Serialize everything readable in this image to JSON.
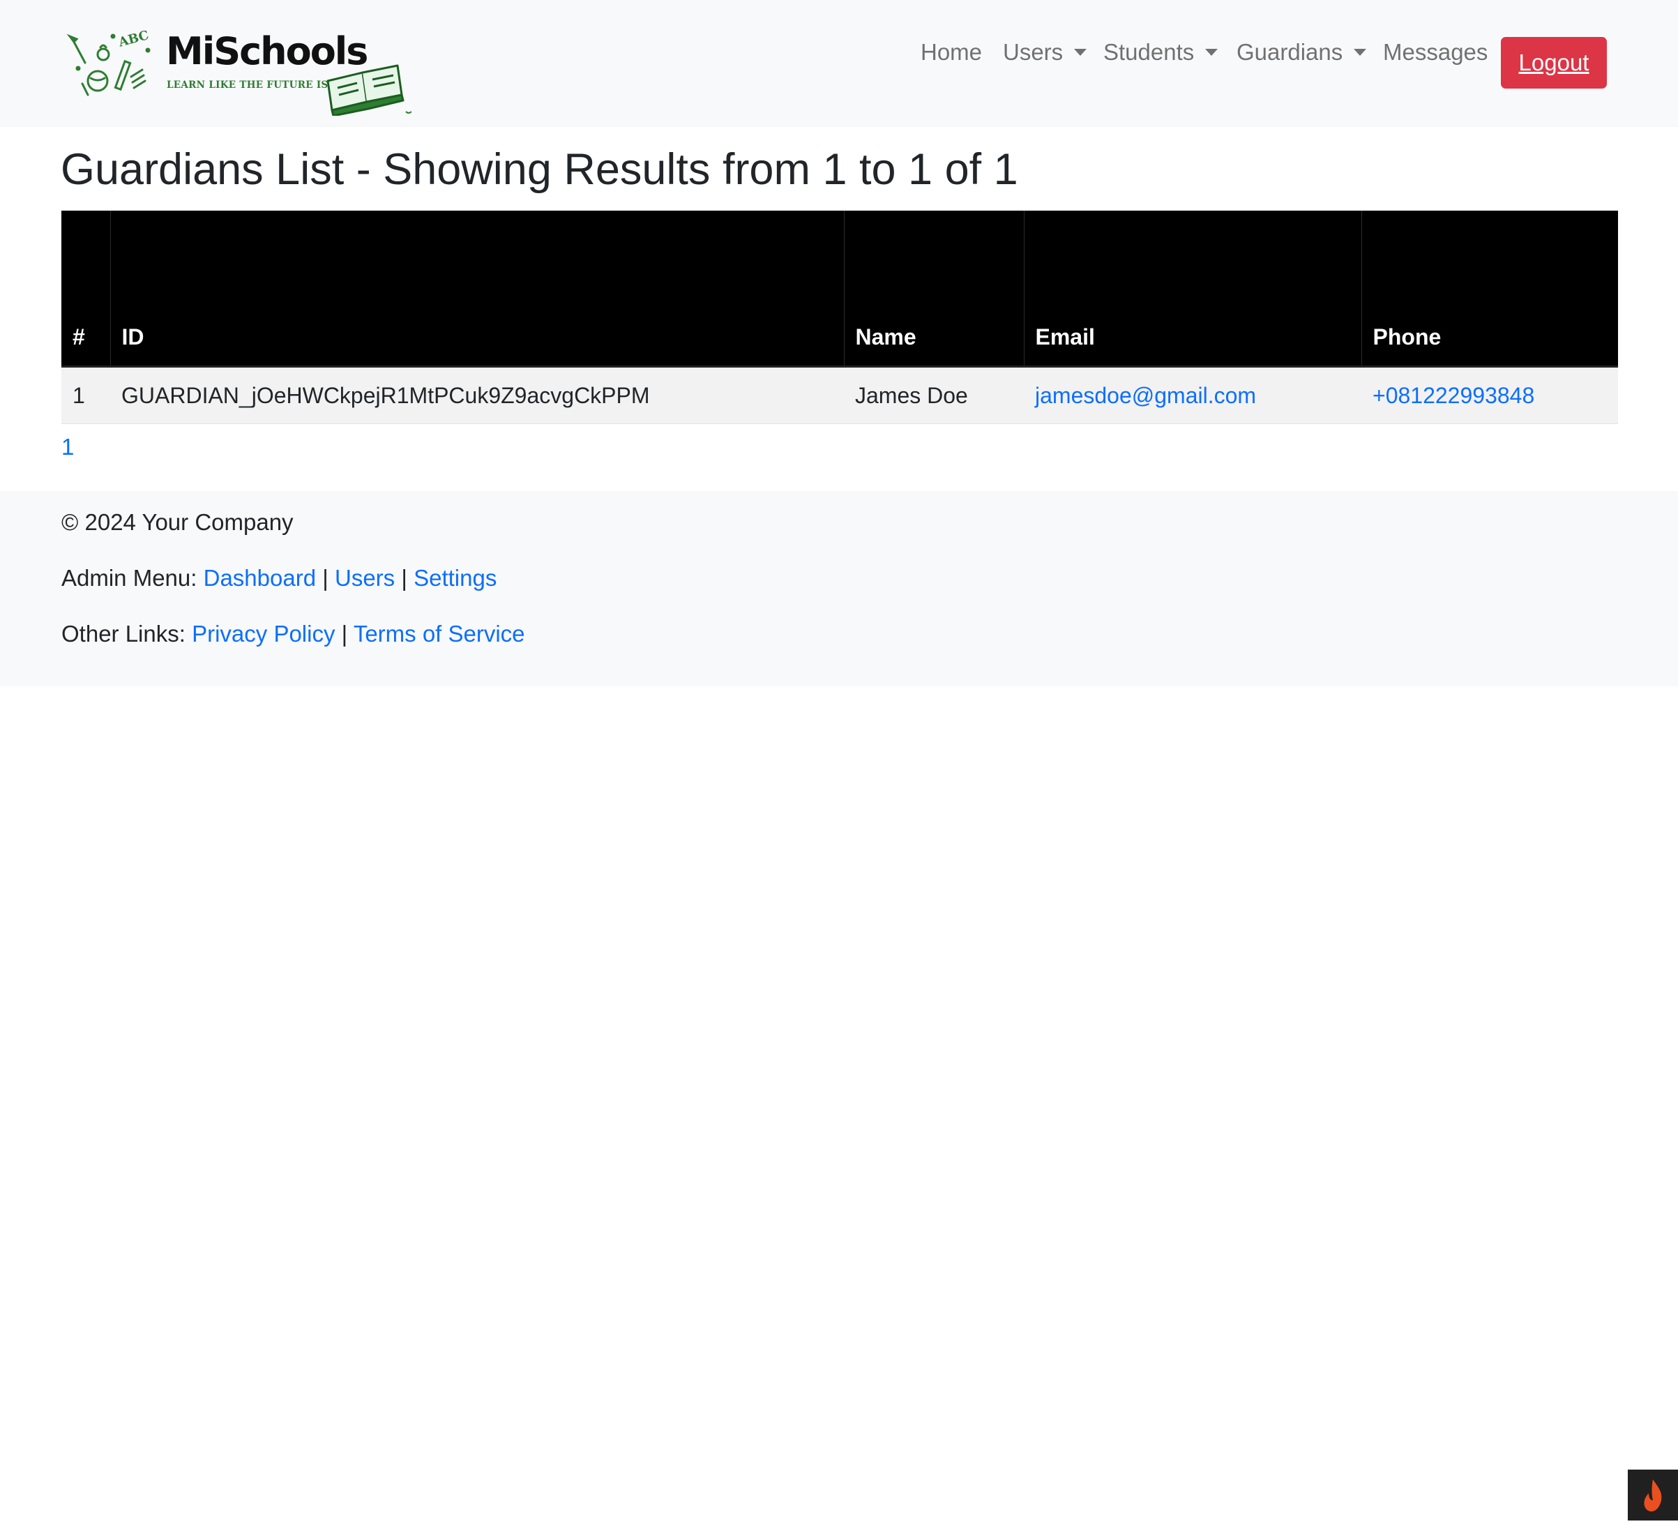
{
  "navbar": {
    "brand": {
      "name": "MiSchools",
      "tagline": "LEARN LIKE THE FUTURE IS NOW"
    },
    "links": [
      {
        "label": "Home",
        "dropdown": false
      },
      {
        "label": "Users",
        "dropdown": true
      },
      {
        "label": "Students",
        "dropdown": true
      },
      {
        "label": "Guardians",
        "dropdown": true
      },
      {
        "label": "Messages",
        "dropdown": false
      }
    ],
    "logout_label": "Logout"
  },
  "main": {
    "title": "Guardians List - Showing Results from 1 to 1 of 1",
    "table": {
      "columns": [
        "#",
        "ID",
        "Name",
        "Email",
        "Phone"
      ],
      "rows": [
        {
          "num": "1",
          "id": "GUARDIAN_jOeHWCkpejR1MtPCuk9Z9acvgCkPPM",
          "name": "James Doe",
          "email": "jamesdoe@gmail.com",
          "phone": "+081222993848"
        }
      ]
    },
    "pagination": [
      "1"
    ]
  },
  "footer": {
    "copyright": "© 2024 Your Company",
    "admin_menu": {
      "label": "Admin Menu:",
      "links": [
        "Dashboard",
        "Users",
        "Settings"
      ],
      "separator": "|"
    },
    "other_links": {
      "label": "Other Links:",
      "links": [
        "Privacy Policy",
        "Terms of Service"
      ],
      "separator": "|"
    }
  },
  "icons": {
    "brand_logo": "school-doodle-logo-icon",
    "book": "open-book-icon",
    "dropdown": "chevron-down-icon",
    "corner": "flame-icon"
  },
  "colors": {
    "navbar_bg": "#f8f9fa",
    "logout_bg": "#dc3545",
    "table_header_bg": "#000000",
    "row_bg": "#f2f2f2",
    "link": "#0d6efd",
    "brand_green": "#2e7d32"
  }
}
